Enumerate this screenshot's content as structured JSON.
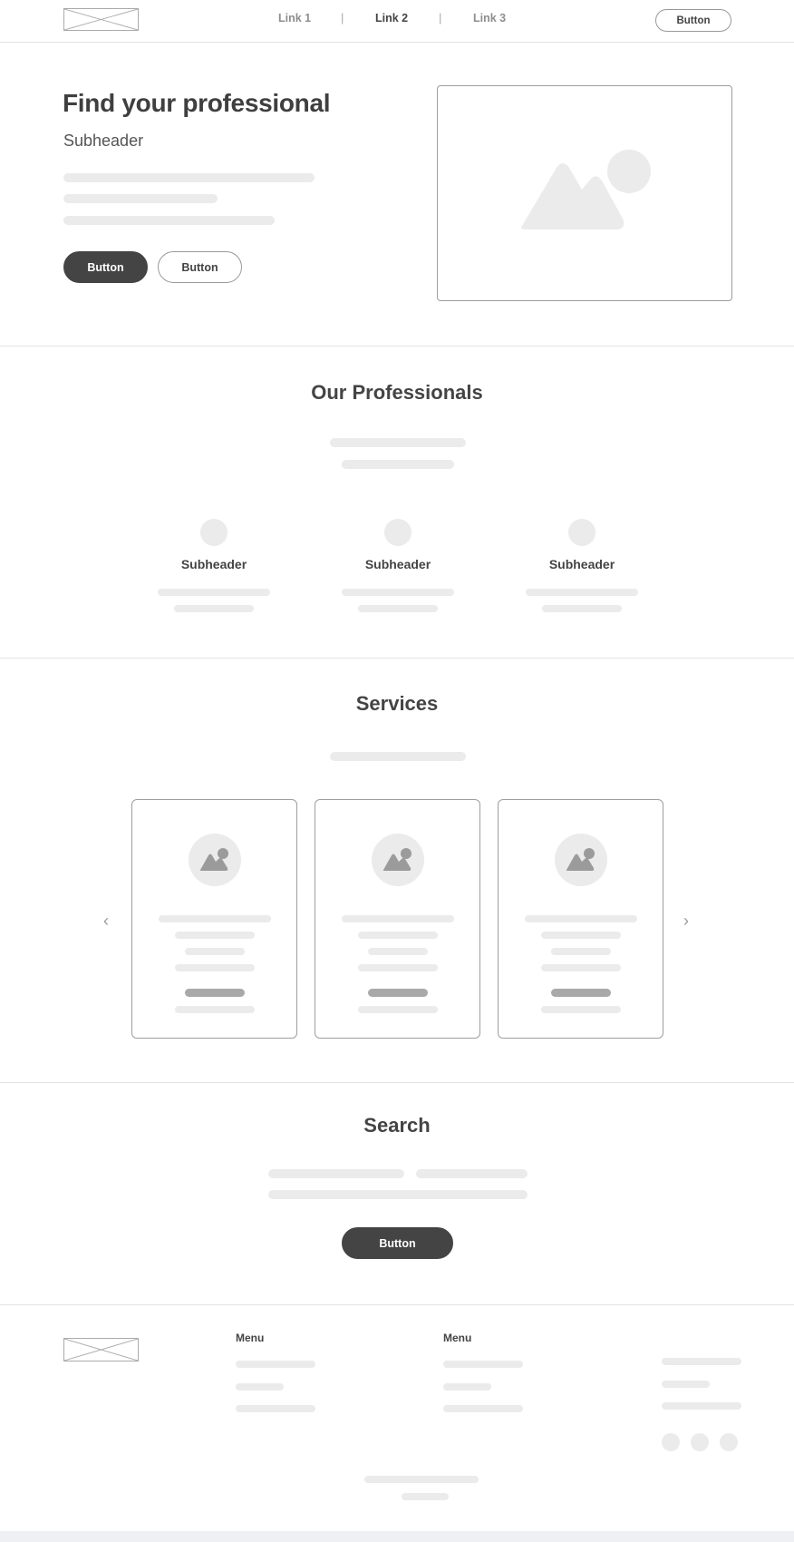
{
  "nav": {
    "links": [
      {
        "label": "Link 1",
        "active": false
      },
      {
        "label": "Link 2",
        "active": true
      },
      {
        "label": "Link 3",
        "active": false
      }
    ],
    "separator": "|",
    "button_label": "Button"
  },
  "hero": {
    "title": "Find your professional",
    "subheader": "Subheader",
    "primary_button": "Button",
    "secondary_button": "Button"
  },
  "professionals": {
    "title": "Our Professionals",
    "items": [
      {
        "subheader": "Subheader"
      },
      {
        "subheader": "Subheader"
      },
      {
        "subheader": "Subheader"
      }
    ]
  },
  "services": {
    "title": "Services",
    "prev_icon": "chevron-left-icon",
    "next_icon": "chevron-right-icon"
  },
  "search": {
    "title": "Search",
    "button_label": "Button"
  },
  "footer": {
    "menus": [
      {
        "title": "Menu"
      },
      {
        "title": "Menu"
      }
    ]
  },
  "colors": {
    "dark": "#444444",
    "placeholder": "#ebebeb",
    "border": "#9e9e9e"
  }
}
